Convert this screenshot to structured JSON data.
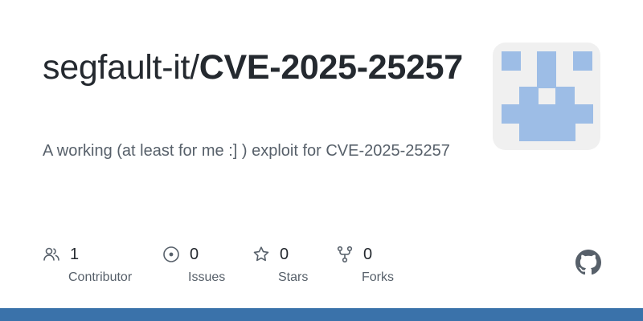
{
  "repo": {
    "owner_prefix": "segfault-it/",
    "name": "CVE-2025-25257",
    "description": "A working (at least for me :] ) exploit for CVE-2025-25257"
  },
  "stats": {
    "contributors": {
      "count": "1",
      "label": "Contributor",
      "icon": "people-icon"
    },
    "issues": {
      "count": "0",
      "label": "Issues",
      "icon": "issue-opened-icon"
    },
    "stars": {
      "count": "0",
      "label": "Stars",
      "icon": "star-icon"
    },
    "forks": {
      "count": "0",
      "label": "Forks",
      "icon": "repo-forked-icon"
    }
  },
  "colors": {
    "accent_bar": "#3a72aa",
    "identicon": "#9dbde6",
    "identicon_bg": "#f0f0f0",
    "title": "#24292f",
    "muted": "#57606a"
  }
}
